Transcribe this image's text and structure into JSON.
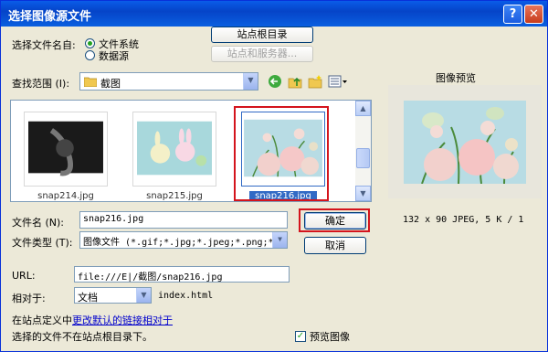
{
  "window": {
    "title": "选择图像源文件"
  },
  "titlebar": {
    "help_symbol": "?",
    "close_symbol": "✕"
  },
  "select_name": {
    "label": "选择文件名自:",
    "option_filesystem": "文件系统",
    "option_datasource": "数据源",
    "selected": "文件系统"
  },
  "top_buttons": {
    "site_root": "站点根目录",
    "site_server": "站点和服务器..."
  },
  "lookin": {
    "label": "查找范围 (I):",
    "value": "截图"
  },
  "files": [
    {
      "name": "snap214.jpg",
      "caption": "snap214.jpg"
    },
    {
      "name": "snap215.jpg",
      "caption": "snap215.jpg"
    },
    {
      "name": "snap216.jpg",
      "caption": "snap216.jpg",
      "selected": true
    }
  ],
  "filename": {
    "label": "文件名 (N):",
    "value": "snap216.jpg"
  },
  "filetype": {
    "label": "文件类型 (T):",
    "value": "图像文件 (*.gif;*.jpg;*.jpeg;*.png;*"
  },
  "buttons": {
    "ok": "确定",
    "cancel": "取消"
  },
  "url": {
    "label": "URL:",
    "value": "file:///E|/截图/snap216.jpg"
  },
  "relative": {
    "label": "相对于:",
    "value": "文档",
    "page": "index.html"
  },
  "footer": {
    "line1_prefix": "在站点定义中",
    "line1_link": "更改默认的链接相对于",
    "line2": "选择的文件不在站点根目录下。"
  },
  "preview": {
    "title": "图像预览",
    "info": "132 x 90 JPEG, 5 K / 1",
    "checkbox_label": "预览图像",
    "checked": true
  },
  "colors": {
    "highlight": "#d4141c",
    "title_bg": "#0a5ce8",
    "dialog_bg": "#ece9d8"
  }
}
